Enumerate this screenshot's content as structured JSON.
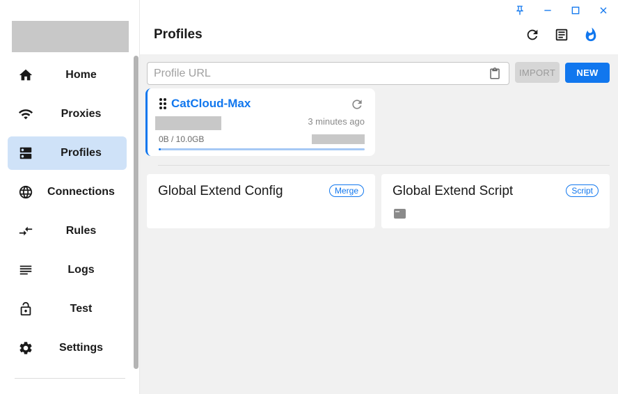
{
  "sidebar": {
    "items": [
      {
        "label": "Home",
        "icon": "home-icon"
      },
      {
        "label": "Proxies",
        "icon": "wifi-icon"
      },
      {
        "label": "Profiles",
        "icon": "dns-icon",
        "active": true
      },
      {
        "label": "Connections",
        "icon": "globe-icon"
      },
      {
        "label": "Rules",
        "icon": "fork-arrow-icon"
      },
      {
        "label": "Logs",
        "icon": "lines-icon"
      },
      {
        "label": "Test",
        "icon": "lock-open-icon"
      },
      {
        "label": "Settings",
        "icon": "gear-icon"
      }
    ]
  },
  "window": {
    "controls": [
      "pin-icon",
      "minimize-icon",
      "maximize-icon",
      "close-icon"
    ]
  },
  "header": {
    "title": "Profiles",
    "actions": [
      "refresh-icon",
      "document-icon",
      "flame-icon"
    ]
  },
  "url_bar": {
    "placeholder": "Profile URL",
    "value": "",
    "import_label": "IMPORT",
    "new_label": "NEW"
  },
  "profile": {
    "name": "CatCloud-Max",
    "updated": "3 minutes ago",
    "usage": "0B / 10.0GB",
    "progress": 0.01
  },
  "extend": {
    "config": {
      "title": "Global Extend Config",
      "badge": "Merge"
    },
    "script": {
      "title": "Global Extend Script",
      "badge": "Script"
    }
  },
  "colors": {
    "accent": "#1177ee",
    "active_nav": "#cfe2f8",
    "background": "#f1f1f1"
  }
}
